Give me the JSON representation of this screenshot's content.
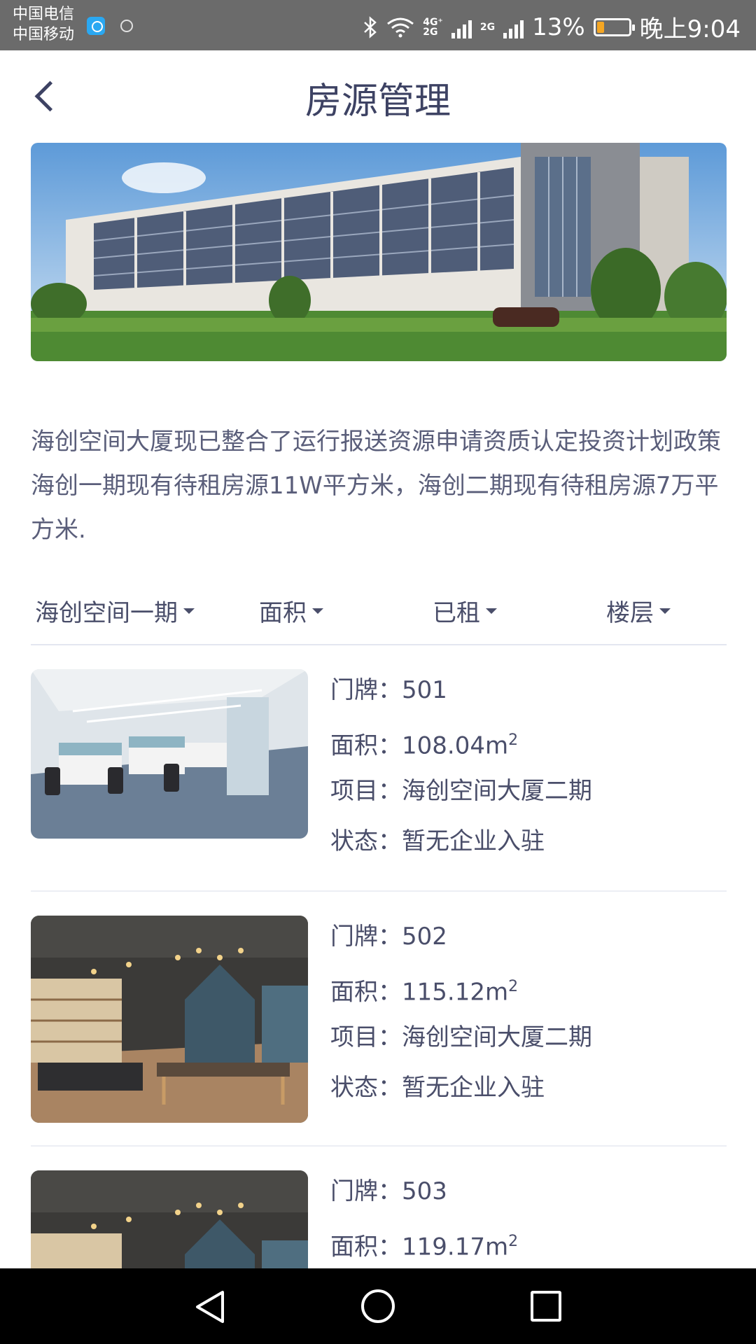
{
  "status_bar": {
    "carrier_1": "中国电信",
    "carrier_2": "中国移动",
    "network_1": "4G⁺",
    "network_1_sub": "2G",
    "network_2": "2G",
    "battery_percent": "13%",
    "battery_level": 0.13,
    "time": "晚上9:04"
  },
  "header": {
    "title": "房源管理"
  },
  "description": "海创空间大厦现已整合了运行报送资源申请资质认定投资计划政策海创一期现有待租房源11W平方米，海创二期现有待租房源7万平方米.",
  "filters": [
    {
      "label": "海创空间一期"
    },
    {
      "label": "面积"
    },
    {
      "label": "已租"
    },
    {
      "label": "楼层"
    }
  ],
  "field_labels": {
    "door": "门牌：",
    "area": "面积：",
    "project": "项目：",
    "status": "状态："
  },
  "area_unit": "m",
  "area_unit_sup": "2",
  "listings": [
    {
      "door": "501",
      "area": "108.04",
      "project": "海创空间大厦二期",
      "status": "暂无企业入驻"
    },
    {
      "door": "502",
      "area": "115.12",
      "project": "海创空间大厦二期",
      "status": "暂无企业入驻"
    },
    {
      "door": "503",
      "area": "119.17"
    }
  ],
  "colors": {
    "title": "#3d4263",
    "text": "#4a4e6a",
    "divider": "#e3e6f0",
    "status_bar": "#6b6b6b",
    "battery_fill": "#f5a623"
  }
}
